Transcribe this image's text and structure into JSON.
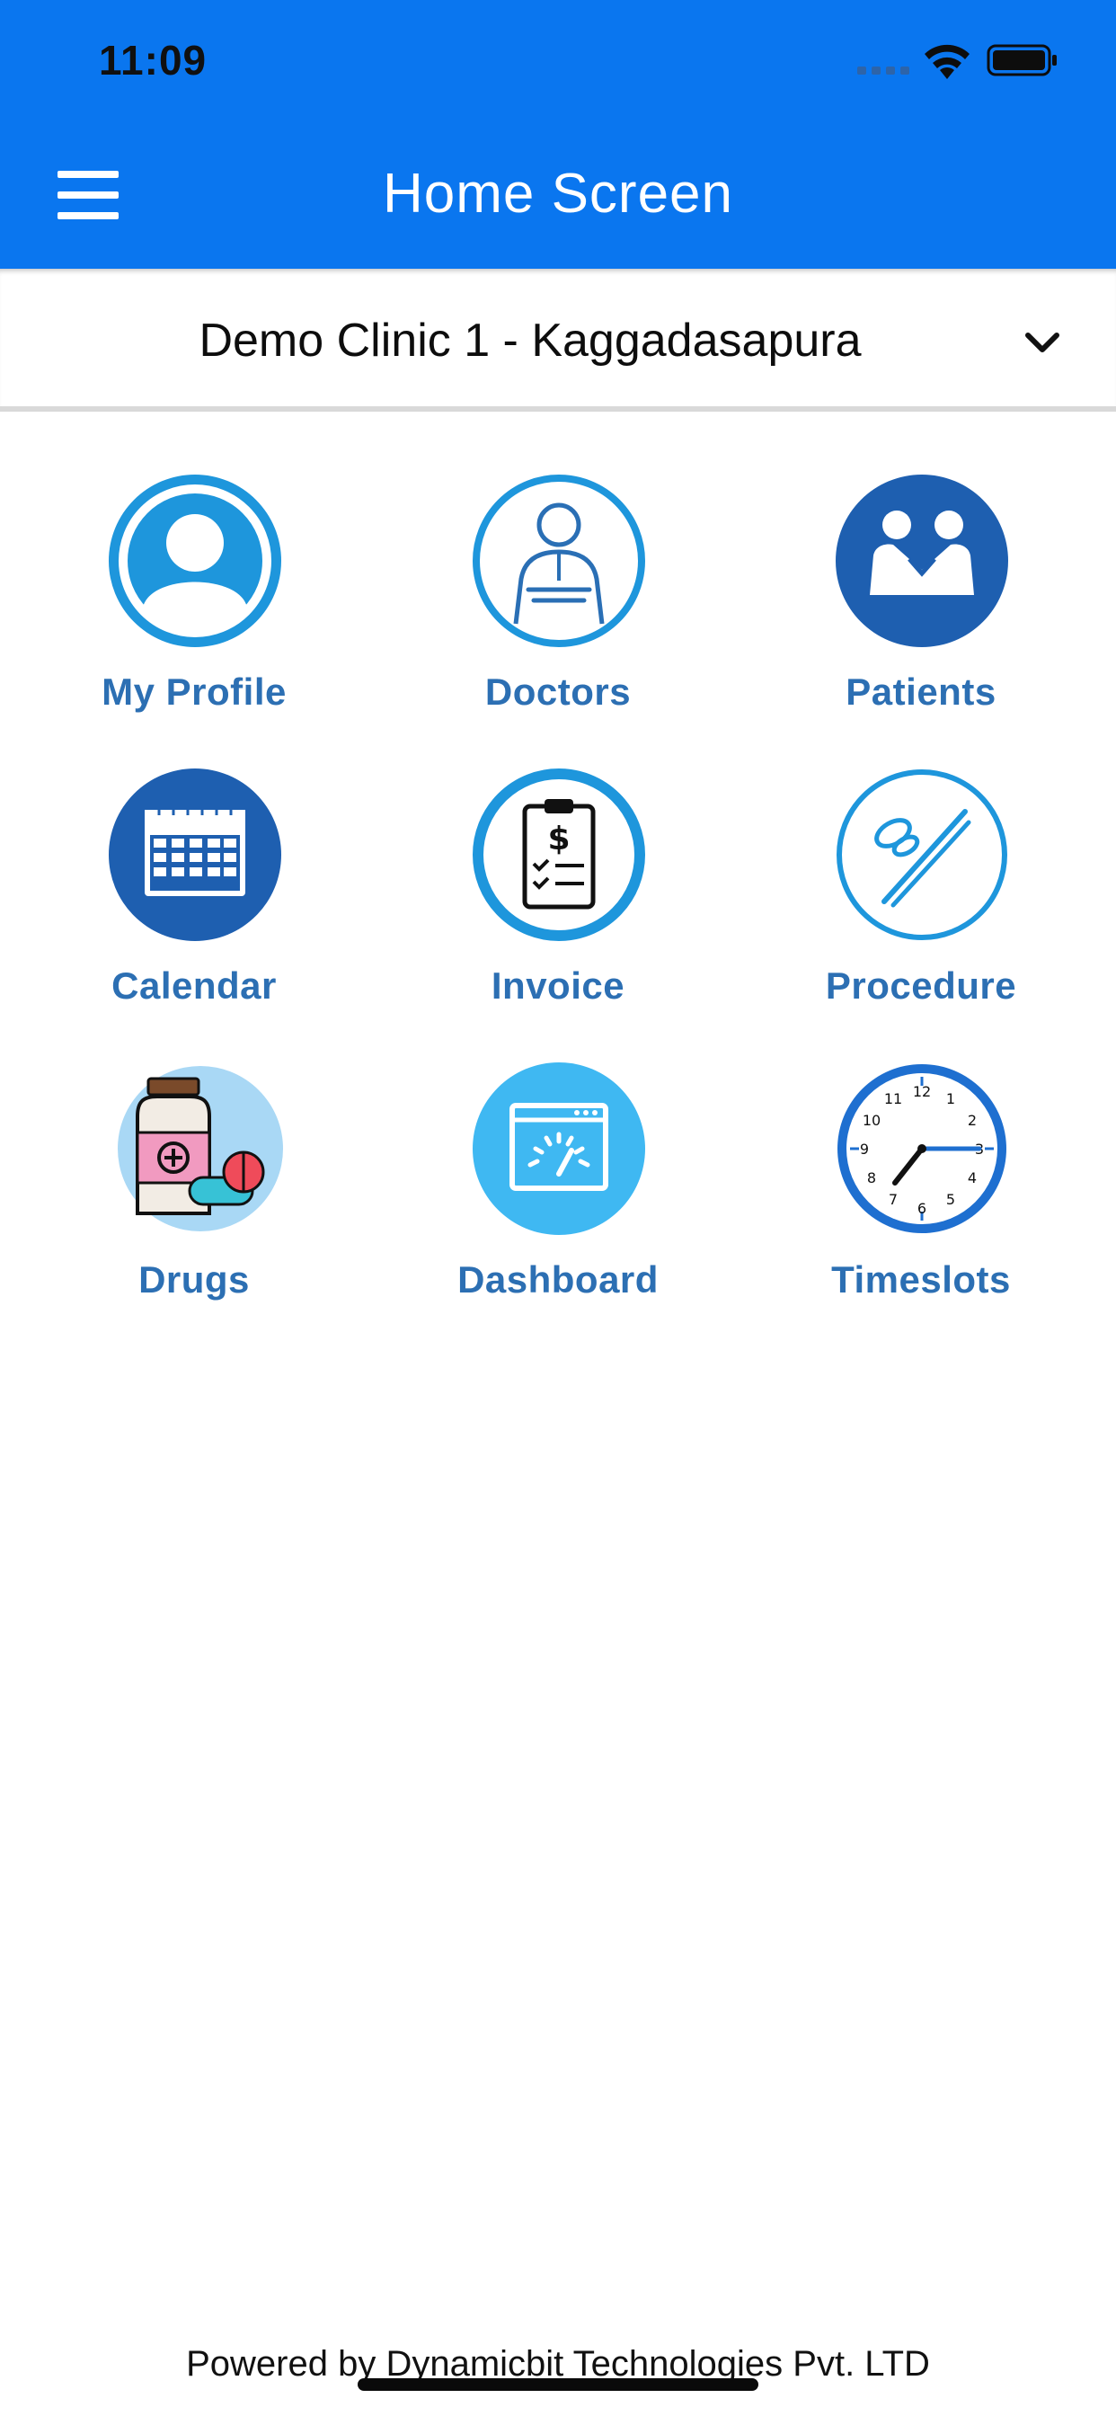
{
  "status_bar": {
    "time": "11:09"
  },
  "nav_bar": {
    "title": "Home Screen"
  },
  "clinic_selector": {
    "selected": "Demo Clinic 1 - Kaggadasapura"
  },
  "menu": {
    "items": [
      {
        "label": "My Profile",
        "icon": "user-profile-icon"
      },
      {
        "label": "Doctors",
        "icon": "doctor-icon"
      },
      {
        "label": "Patients",
        "icon": "handshake-icon"
      },
      {
        "label": "Calendar",
        "icon": "calendar-icon"
      },
      {
        "label": "Invoice",
        "icon": "invoice-clipboard-icon"
      },
      {
        "label": "Procedure",
        "icon": "surgical-tools-icon"
      },
      {
        "label": "Drugs",
        "icon": "medicine-bottle-icon"
      },
      {
        "label": "Dashboard",
        "icon": "speedometer-dashboard-icon"
      },
      {
        "label": "Timeslots",
        "icon": "clock-icon"
      }
    ]
  },
  "footer": {
    "text": "Powered by Dynamicbit Technologies Pvt. LTD"
  },
  "colors": {
    "primary": "#0a76ef",
    "label": "#2c6fb3",
    "icon_blue": "#1e96dc"
  }
}
